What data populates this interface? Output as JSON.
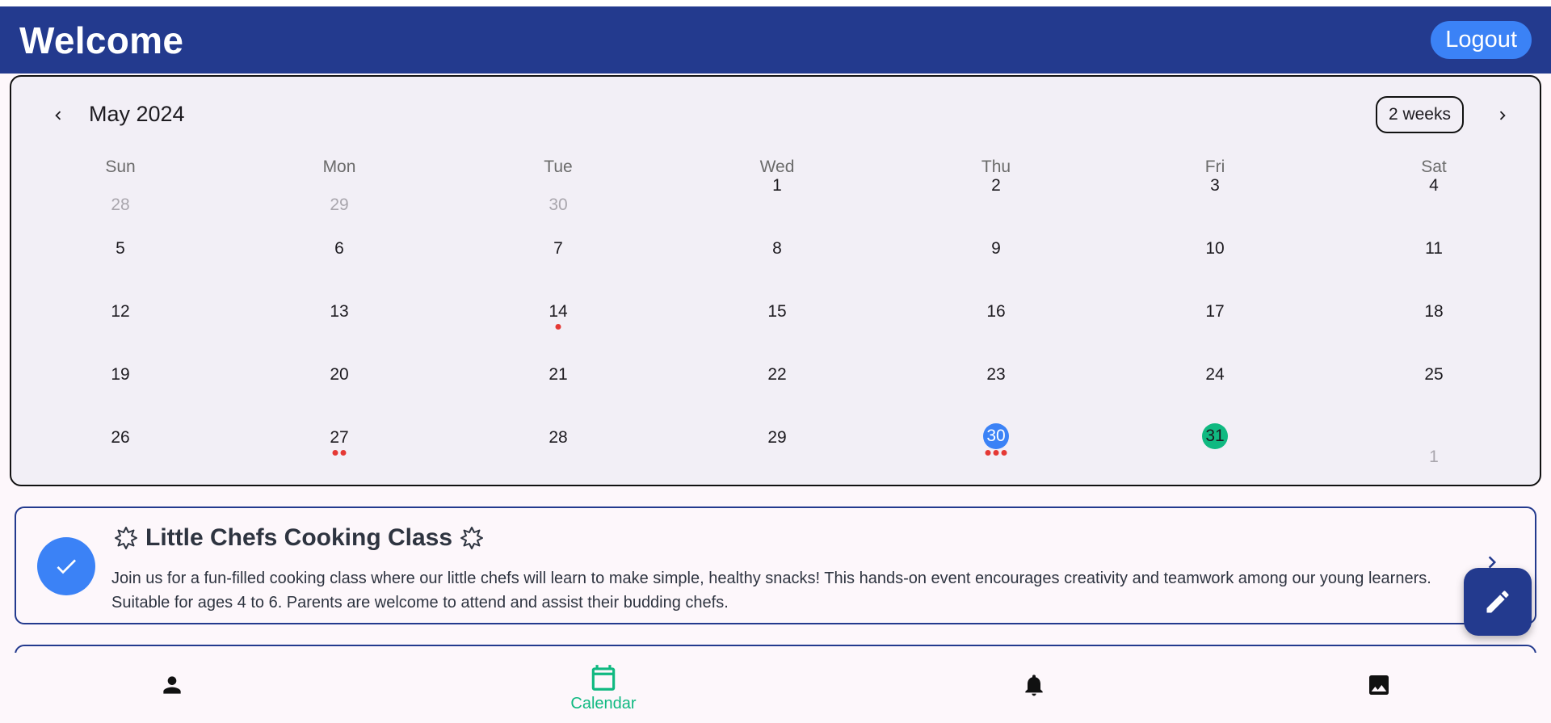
{
  "header": {
    "title": "Welcome",
    "logout_label": "Logout"
  },
  "calendar": {
    "month_label": "May 2024",
    "format_label": "2 weeks",
    "weekdays": [
      "Sun",
      "Mon",
      "Tue",
      "Wed",
      "Thu",
      "Fri",
      "Sat"
    ],
    "weeks": [
      [
        "28",
        "29",
        "30",
        "1",
        "2",
        "3",
        "4"
      ],
      [
        "5",
        "6",
        "7",
        "8",
        "9",
        "10",
        "11"
      ],
      [
        "12",
        "13",
        "14",
        "15",
        "16",
        "17",
        "18"
      ],
      [
        "19",
        "20",
        "21",
        "22",
        "23",
        "24",
        "25"
      ],
      [
        "26",
        "27",
        "28",
        "29",
        "30",
        "31",
        "1"
      ]
    ],
    "outside_days": [
      "28",
      "29",
      "30",
      "1-next"
    ],
    "selected_day": "30",
    "today_day": "31",
    "event_markers": {
      "14": 1,
      "27": 2,
      "30": 3
    },
    "colors": {
      "selected": "#3b82f6",
      "today": "#10b981",
      "marker": "#e53935"
    }
  },
  "events": [
    {
      "title": "Little Chefs Cooking Class",
      "description": "Join us for a fun-filled cooking class where our little chefs will learn to make simple, healthy snacks! This hands-on event encourages creativity and teamwork among our young learners. Suitable for ages 4 to 6. Parents are welcome to attend and assist their budding chefs.",
      "icon": "check-icon"
    }
  ],
  "bottom_nav": {
    "items": [
      {
        "icon": "person-icon",
        "label": ""
      },
      {
        "icon": "calendar-icon",
        "label": "Calendar"
      },
      {
        "icon": "bell-icon",
        "label": ""
      },
      {
        "icon": "image-icon",
        "label": ""
      }
    ],
    "active_color": "#10b981"
  },
  "theme": {
    "primary": "#233a8e",
    "accent": "#3b82f6",
    "success": "#10b981"
  }
}
